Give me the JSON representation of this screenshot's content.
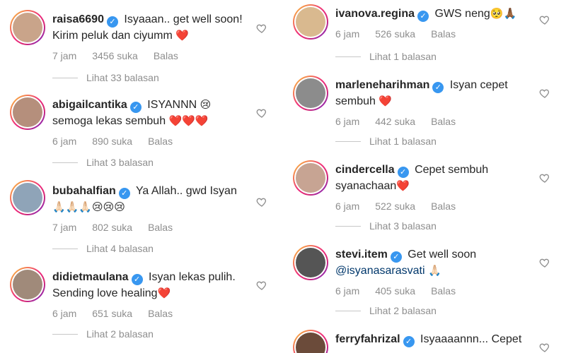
{
  "left": [
    {
      "user": "raisa6690",
      "text": "Isyaaan.. get well soon!",
      "text2": "Kirim peluk dan ciyumm",
      "emoji": "❤️",
      "time": "7 jam",
      "likes": "3456 suka",
      "reply": "Balas",
      "view_replies": "Lihat 33 balasan",
      "pic_color": "#c9a48a"
    },
    {
      "user": "abigailcantika",
      "text": "ISYANNN",
      "emoji_a": "😢",
      "text2": "semoga lekas sembuh",
      "emoji": "❤️❤️❤️",
      "time": "6 jam",
      "likes": "890 suka",
      "reply": "Balas",
      "view_replies": "Lihat 3 balasan",
      "pic_color": "#b58f7c"
    },
    {
      "user": "bubahalfian",
      "text": "Ya Allah.. gwd Isyan",
      "text2": "",
      "emoji": "🙏🏻🙏🏻🙏🏻😢😢😢",
      "time": "7 jam",
      "likes": "802 suka",
      "reply": "Balas",
      "view_replies": "Lihat 4 balasan",
      "pic_color": "#8fa4b8"
    },
    {
      "user": "didietmaulana",
      "text": "Isyan lekas pulih.",
      "text2": "Sending love healing",
      "emoji": "❤️",
      "time": "6 jam",
      "likes": "651 suka",
      "reply": "Balas",
      "view_replies": "Lihat 2 balasan",
      "pic_color": "#a08a7a"
    }
  ],
  "right": [
    {
      "user": "ivanova.regina",
      "text": "GWS neng",
      "emoji_a": "🥺🙏🏾",
      "text2": "",
      "emoji": "",
      "time": "6 jam",
      "likes": "526 suka",
      "reply": "Balas",
      "view_replies": "Lihat 1 balasan",
      "pic_color": "#d9b98f"
    },
    {
      "user": "marleneharihman",
      "text": "Isyan cepet",
      "text2": "sembuh",
      "emoji": "❤️",
      "time": "6 jam",
      "likes": "442 suka",
      "reply": "Balas",
      "view_replies": "Lihat 1 balasan",
      "pic_color": "#8c8c8c"
    },
    {
      "user": "cindercella",
      "text": "Cepet sembuh",
      "text2": "syanachaan",
      "emoji": "❤️",
      "time": "6 jam",
      "likes": "522 suka",
      "reply": "Balas",
      "view_replies": "Lihat 3 balasan",
      "pic_color": "#c7a493"
    },
    {
      "user": "stevi.item",
      "text": "Get well soon",
      "text2": "@isyanasarasvati",
      "emoji": "🙏🏻",
      "time": "6 jam",
      "likes": "405 suka",
      "reply": "Balas",
      "view_replies": "Lihat 2 balasan",
      "pic_color": "#555555"
    },
    {
      "user": "ferryfahrizal",
      "text": "Isyaaaannn... Cepet",
      "text2": "",
      "emoji": "",
      "time": "",
      "likes": "",
      "reply": "",
      "view_replies": "",
      "pic_color": "#6b4b3a"
    }
  ],
  "colors": {
    "accent": "#3897f0",
    "muted": "#8e8e8e",
    "text": "#262626",
    "heart": "#ed4956"
  },
  "icons": {
    "verified": "verified-badge-icon",
    "like": "heart-outline-icon"
  }
}
